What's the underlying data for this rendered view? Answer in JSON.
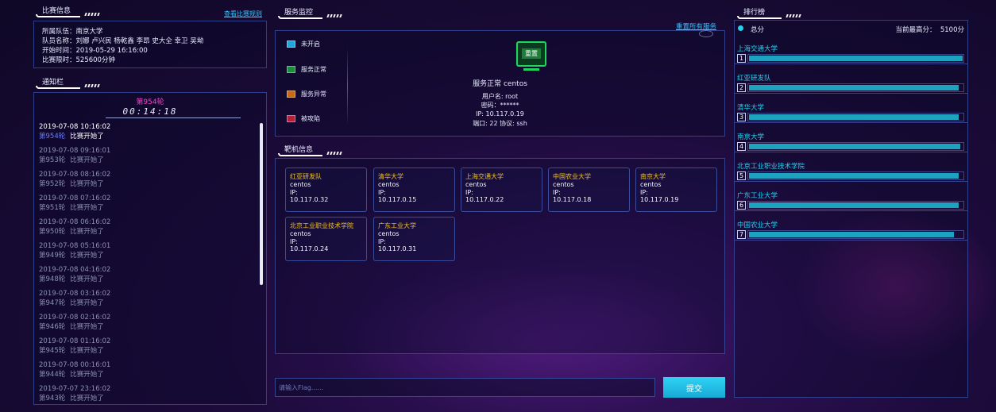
{
  "match_info": {
    "title": "比赛信息",
    "rules_link": "查看比赛规则",
    "rows": [
      {
        "label": "所属队伍：",
        "value": "南京大学"
      },
      {
        "label": "队员名称：",
        "value": "刘娜 卢兴民 杨乾鑫 李昂 史大全 幸卫 吴坳"
      },
      {
        "label": "开始时间：",
        "value": "2019-05-29 16:16:00"
      },
      {
        "label": "比赛限时：",
        "value": "525600分钟"
      }
    ]
  },
  "notice": {
    "title": "通知栏",
    "round_label": "第954轮",
    "timer": "00:14:18",
    "items": [
      {
        "time": "2019-07-08 10:16:02",
        "round": "第954轮",
        "msg": "比赛开始了"
      },
      {
        "time": "2019-07-08 09:16:01",
        "round": "第953轮",
        "msg": "比赛开始了"
      },
      {
        "time": "2019-07-08 08:16:02",
        "round": "第952轮",
        "msg": "比赛开始了"
      },
      {
        "time": "2019-07-08 07:16:02",
        "round": "第951轮",
        "msg": "比赛开始了"
      },
      {
        "time": "2019-07-08 06:16:02",
        "round": "第950轮",
        "msg": "比赛开始了"
      },
      {
        "time": "2019-07-08 05:16:01",
        "round": "第949轮",
        "msg": "比赛开始了"
      },
      {
        "time": "2019-07-08 04:16:02",
        "round": "第948轮",
        "msg": "比赛开始了"
      },
      {
        "time": "2019-07-08 03:16:02",
        "round": "第947轮",
        "msg": "比赛开始了"
      },
      {
        "time": "2019-07-08 02:16:02",
        "round": "第946轮",
        "msg": "比赛开始了"
      },
      {
        "time": "2019-07-08 01:16:02",
        "round": "第945轮",
        "msg": "比赛开始了"
      },
      {
        "time": "2019-07-08 00:16:01",
        "round": "第944轮",
        "msg": "比赛开始了"
      },
      {
        "time": "2019-07-07 23:16:02",
        "round": "第943轮",
        "msg": "比赛开始了"
      }
    ]
  },
  "service": {
    "title": "服务监控",
    "reset_link": "重置所有服务",
    "legend": [
      "未开启",
      "服务正常",
      "服务异常",
      "被攻陷"
    ],
    "monitor_label": "重置",
    "status_line": "服务正常 centos",
    "user_line": "用户名: root",
    "pass_line": "密码：******",
    "ip_line": "IP: 10.117.0.19",
    "port_line": "端口: 22  协议: ssh"
  },
  "targets": {
    "title": "靶机信息",
    "os_label": "centos",
    "ip_label": "IP:",
    "items": [
      {
        "name": "红亚研发队",
        "ip": "10.117.0.32"
      },
      {
        "name": "清华大学",
        "ip": "10.117.0.15"
      },
      {
        "name": "上海交通大学",
        "ip": "10.117.0.22"
      },
      {
        "name": "中国农业大学",
        "ip": "10.117.0.18"
      },
      {
        "name": "南京大学",
        "ip": "10.117.0.19"
      },
      {
        "name": "北京工业职业技术学院",
        "ip": "10.117.0.24"
      },
      {
        "name": "广东工业大学",
        "ip": "10.117.0.31"
      }
    ]
  },
  "flag": {
    "placeholder": "请输入Flag......",
    "submit_label": "提交"
  },
  "ranking": {
    "title": "排行榜",
    "total_label": "总分",
    "high_score": "当前最高分：  5100分",
    "items": [
      {
        "rank": "1",
        "name": "上海交通大学",
        "fill": 1.0
      },
      {
        "rank": "2",
        "name": "红亚研发队",
        "fill": 0.98
      },
      {
        "rank": "3",
        "name": "清华大学",
        "fill": 0.98
      },
      {
        "rank": "4",
        "name": "南京大学",
        "fill": 0.99
      },
      {
        "rank": "5",
        "name": "北京工业职业技术学院",
        "fill": 0.98
      },
      {
        "rank": "6",
        "name": "广东工业大学",
        "fill": 0.98
      },
      {
        "rank": "7",
        "name": "中国农业大学",
        "fill": 0.96
      }
    ]
  },
  "colors": {
    "accent_cyan": "#1fd3f0",
    "target_name": "#f3c21b",
    "round_magenta": "#ff3fd0",
    "bar_fill": "#1da2bf"
  }
}
